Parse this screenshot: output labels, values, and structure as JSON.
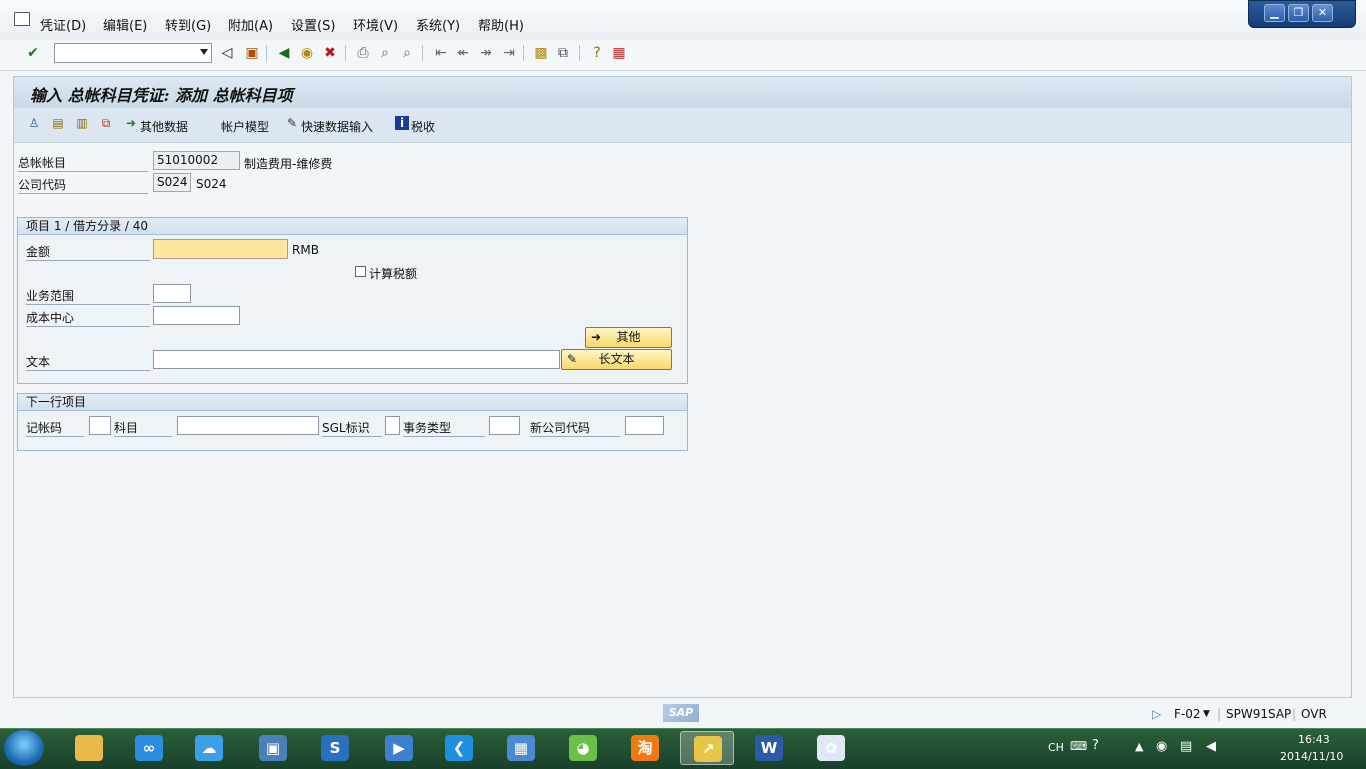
{
  "menu": [
    "凭证(D)",
    "编辑(E)",
    "转到(G)",
    "附加(A)",
    "设置(S)",
    "环境(V)",
    "系统(Y)",
    "帮助(H)"
  ],
  "window_controls": [
    "minimize",
    "restore",
    "close"
  ],
  "toolbar": {
    "command_field_value": "",
    "icons": [
      "enter-icon",
      "back-arrow-icon",
      "save-icon",
      "back-icon",
      "exit-icon",
      "cancel-icon",
      "print-icon",
      "find-icon",
      "find-next-icon",
      "first-page-icon",
      "prev-page-icon",
      "next-page-icon",
      "last-page-icon",
      "new-session-icon",
      "shortcut-icon",
      "help-icon",
      "layout-icon"
    ]
  },
  "screen": {
    "title": "输入 总帐科目凭证: 添加 总帐科目项"
  },
  "app_toolbar": {
    "other_data": "其他数据",
    "account_model": "帐户模型",
    "fast_entry": "快速数据输入",
    "taxes": "税收"
  },
  "header": {
    "gl_account_label": "总帐帐目",
    "gl_account_value": "51010002",
    "gl_account_desc": "制造费用-维修费",
    "company_code_label": "公司代码",
    "company_code_value": "S024",
    "company_code_desc": "S024"
  },
  "item_group": {
    "title": "项目 1 / 借方分录 / 40",
    "amount_label": "金额",
    "amount_value": "",
    "currency": "RMB",
    "calc_tax_label": "计算税额",
    "calc_tax_checked": false,
    "business_area_label": "业务范围",
    "business_area_value": "",
    "cost_center_label": "成本中心",
    "cost_center_value": "",
    "more_button": "其他",
    "text_label": "文本",
    "text_value": "",
    "long_text_button": "长文本"
  },
  "next_item_group": {
    "title": "下一行项目",
    "posting_key_label": "记帐码",
    "posting_key_value": "",
    "account_label": "科目",
    "account_value": "",
    "sgl_label": "SGL标识",
    "sgl_value": "",
    "trans_type_label": "事务类型",
    "trans_type_value": "",
    "new_company_label": "新公司代码",
    "new_company_value": ""
  },
  "status_bar": {
    "sap_logo": "SAP",
    "transaction": "F-02",
    "server": "SPW91SAP",
    "mode": "OVR"
  },
  "taskbar": {
    "apps": [
      {
        "name": "file-explorer-icon",
        "glyph": "",
        "color": "#e9b94a"
      },
      {
        "name": "baidu-cloud-icon",
        "glyph": "∞",
        "color": "#2a8ee0"
      },
      {
        "name": "cloud-drive-icon",
        "glyph": "☁",
        "color": "#3b9fe8"
      },
      {
        "name": "remote-desktop-icon",
        "glyph": "▣",
        "color": "#4a7fb8"
      },
      {
        "name": "sogou-icon",
        "glyph": "S",
        "color": "#2a6fc0"
      },
      {
        "name": "media-player-icon",
        "glyph": "▶",
        "color": "#3d7fd0"
      },
      {
        "name": "browser-icon",
        "glyph": "❮",
        "color": "#1e90e0"
      },
      {
        "name": "video-icon",
        "glyph": "▦",
        "color": "#4a8ad0"
      },
      {
        "name": "360-browser-icon",
        "glyph": "◕",
        "color": "#6cc04a"
      },
      {
        "name": "taobao-icon",
        "glyph": "淘",
        "color": "#f07a10"
      },
      {
        "name": "sap-logon-icon",
        "glyph": "↗",
        "color": "#e8c64a"
      },
      {
        "name": "word-icon",
        "glyph": "W",
        "color": "#2b5aa8"
      },
      {
        "name": "gallery-icon",
        "glyph": "✿",
        "color": "#e0e8f4"
      }
    ],
    "tray_lang": "CH",
    "time": "16:43",
    "date": "2014/11/10"
  }
}
